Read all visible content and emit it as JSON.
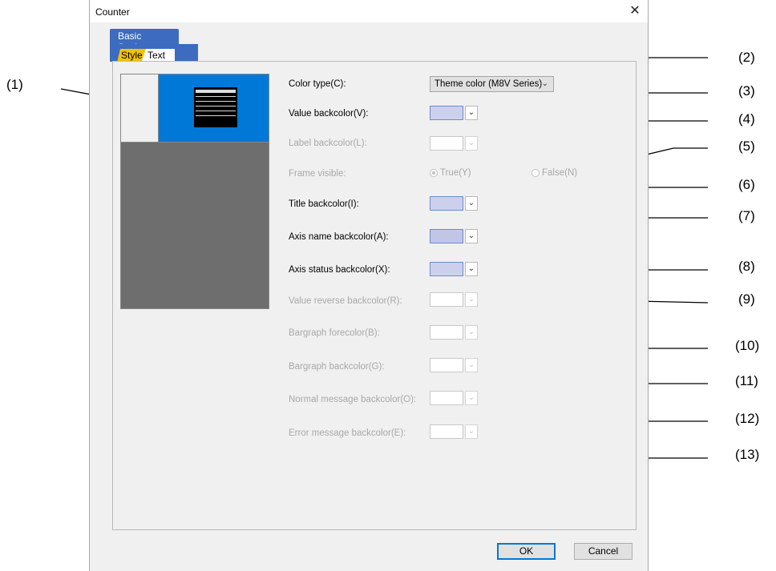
{
  "window": {
    "title": "Counter",
    "close_glyph": "✕"
  },
  "group_tab": "Basic Settings",
  "tabs": [
    {
      "label": "Style"
    },
    {
      "label": "Text"
    }
  ],
  "color_type": {
    "label": "Color type(C):",
    "value": "Theme color (M8V Series)"
  },
  "fields": [
    {
      "label": "Value backcolor(V):",
      "enabled": true,
      "color": "#cdd0ec"
    },
    {
      "label": "Label backcolor(L):",
      "enabled": false,
      "color": "#ffffff"
    },
    {
      "label": "Title backcolor(I):",
      "enabled": true,
      "color": "#cdd0ec"
    },
    {
      "label": "Axis name backcolor(A):",
      "enabled": true,
      "color": "#c2c6e6"
    },
    {
      "label": "Axis status backcolor(X):",
      "enabled": true,
      "color": "#cdd0ec"
    },
    {
      "label": "Value reverse backcolor(R):",
      "enabled": false,
      "color": "#ffffff"
    },
    {
      "label": "Bargraph forecolor(B):",
      "enabled": false,
      "color": "#ffffff"
    },
    {
      "label": "Bargraph backcolor(G):",
      "enabled": false,
      "color": "#ffffff"
    },
    {
      "label": "Normal message backcolor(O):",
      "enabled": false,
      "color": "#ffffff"
    },
    {
      "label": "Error message backcolor(E):",
      "enabled": false,
      "color": "#ffffff"
    }
  ],
  "frame_visible": {
    "label": "Frame visible:",
    "true_label": "True(Y)",
    "false_label": "False(N)"
  },
  "buttons": {
    "ok": "OK",
    "cancel": "Cancel"
  },
  "preview": {
    "header_text": "Relative posn",
    "rows": [
      "X1 22000.000000",
      "Y1 22000.000000",
      "Z1 22000.000000",
      "A1 22000.000000",
      "B1 22000.000000"
    ]
  },
  "callouts": [
    "(1)",
    "(2)",
    "(3)",
    "(4)",
    "(5)",
    "(6)",
    "(7)",
    "(8)",
    "(9)",
    "(10)",
    "(11)",
    "(12)",
    "(13)"
  ],
  "colors": {
    "tab_active": "#f2c300",
    "tab_bar": "#3d6bbf",
    "preview_blue": "#0078d7",
    "swatch_border": "#6a8dcc"
  },
  "icons": {
    "close": "close-icon",
    "dropdown": "chevron-down-icon"
  }
}
